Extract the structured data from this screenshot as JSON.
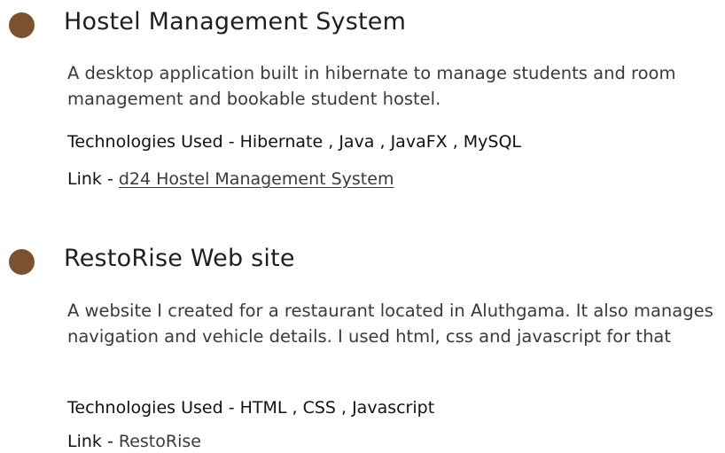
{
  "projects": [
    {
      "title": "Hostel Management System",
      "description": "A desktop application built in hibernate to manage students and room management and bookable student hostel.",
      "technologies": "Technologies Used - Hibernate , Java , JavaFX , MySQL",
      "link_label": "Link - ",
      "link_text": "d24 Hostel Management System "
    },
    {
      "title": "RestoRise Web site",
      "description": "A website I created for a restaurant located in Aluthgama. It also manages navigation and vehicle details. I used html, css and javascript for that",
      "technologies": "Technologies Used - HTML , CSS , Javascript",
      "link_label": "Link - ",
      "link_text": "RestoRise"
    }
  ],
  "colors": {
    "bullet": "#7a5230"
  }
}
